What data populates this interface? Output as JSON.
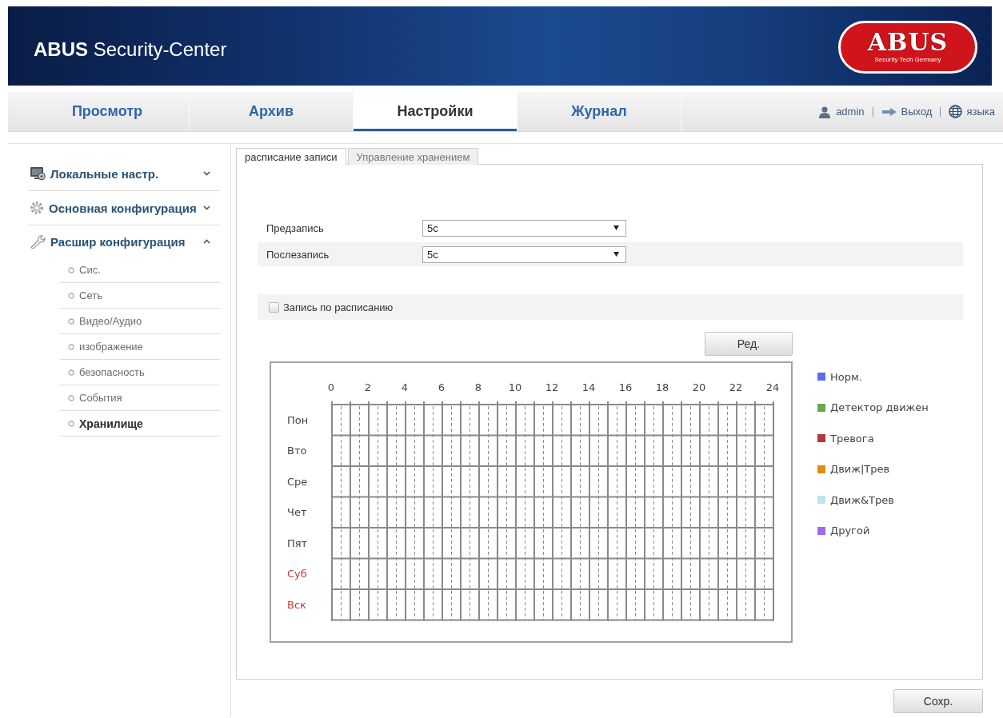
{
  "header": {
    "title": "**ABUS** Security-Center",
    "logo": {
      "wordmark": "ABUS",
      "tagline": "Security Tech Germany"
    }
  },
  "nav": {
    "tabs": [
      {
        "label": "Просмотр",
        "selected": false
      },
      {
        "label": "Архив",
        "selected": false
      },
      {
        "label": "Настройки",
        "selected": true
      },
      {
        "label": "Журнал",
        "selected": false
      }
    ],
    "user": "admin",
    "logout": "Выход",
    "language": "языка"
  },
  "sidebar": {
    "sections": [
      {
        "label": "Локальные настр.",
        "expanded": false
      },
      {
        "label": "Основная конфигурация",
        "expanded": false
      },
      {
        "label": "Расшир конфигурация",
        "expanded": true,
        "children": [
          {
            "label": "Сис.",
            "selected": false
          },
          {
            "label": "Сеть",
            "selected": false
          },
          {
            "label": "Видео/Аудио",
            "selected": false
          },
          {
            "label": "изображение",
            "selected": false
          },
          {
            "label": "безопасность",
            "selected": false
          },
          {
            "label": "События",
            "selected": false
          },
          {
            "label": "Хранилище",
            "selected": true
          }
        ]
      }
    ]
  },
  "tabs": [
    {
      "label": "расписание записи",
      "selected": true
    },
    {
      "label": "Управление хранением",
      "selected": false
    }
  ],
  "form": {
    "fields": [
      {
        "label": "Предзапись",
        "value": "5с"
      },
      {
        "label": "Послезапись",
        "value": "5с"
      }
    ]
  },
  "schedule": {
    "checkbox": {
      "label": "Запись по расписанию",
      "checked": false
    },
    "edit_button": "Ред.",
    "hours": [
      "0",
      "2",
      "4",
      "6",
      "8",
      "10",
      "12",
      "14",
      "16",
      "18",
      "20",
      "22",
      "24"
    ],
    "days": [
      {
        "label": "Пон",
        "weekend": false
      },
      {
        "label": "Вто",
        "weekend": false
      },
      {
        "label": "Сре",
        "weekend": false
      },
      {
        "label": "Чет",
        "weekend": false
      },
      {
        "label": "Пят",
        "weekend": false
      },
      {
        "label": "Суб",
        "weekend": true
      },
      {
        "label": "Вск",
        "weekend": true
      }
    ]
  },
  "legend": [
    {
      "label": "Норм.",
      "color": "#5b6ee6"
    },
    {
      "label": "Детектор движен",
      "color": "#6aa84f"
    },
    {
      "label": "Тревога",
      "color": "#b8333a"
    },
    {
      "label": "Движ|Трев",
      "color": "#e38b12"
    },
    {
      "label": "Движ&Трев",
      "color": "#bfe2ef"
    },
    {
      "label": "Другой",
      "color": "#9a6bea"
    }
  ],
  "save_button": "Сохр."
}
